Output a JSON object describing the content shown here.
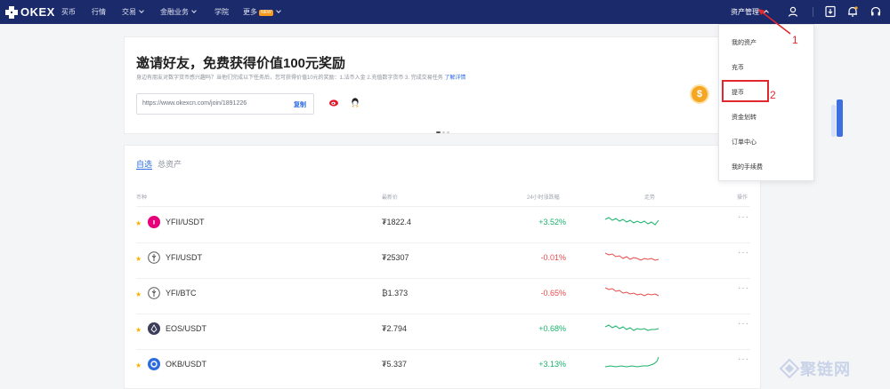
{
  "app": {
    "name": "OKEX"
  },
  "nav": {
    "items": [
      {
        "label": "买币"
      },
      {
        "label": "行情"
      },
      {
        "label": "交易"
      },
      {
        "label": "金融业务"
      },
      {
        "label": "学院"
      },
      {
        "label": "更多"
      }
    ],
    "new_badge": "NEW",
    "asset_management": "资产管理",
    "icons": [
      "user-icon",
      "download-icon",
      "bell-icon",
      "headset-icon"
    ]
  },
  "banner": {
    "title": "邀请好友，免费获得价值100元奖励",
    "subtitle": "身边有朋友对数字货币感兴趣吗？当他们完成以下任务后，您可获得价值10元的奖励：1.法币入金 2.充值数字货币 3. 完成交易任务",
    "learn_more": "了解详情",
    "invite_url": "https://www.okexcn.com/join/1891226",
    "copy_label": "复制",
    "coin_symbol": "$"
  },
  "assets": {
    "tabs": [
      {
        "label": "自选",
        "active": true
      },
      {
        "label": "总资产",
        "active": false
      }
    ],
    "headers": {
      "pair": "币种",
      "price": "最新价",
      "change": "24小时涨跌幅",
      "trend": "走势",
      "action": "操作"
    },
    "rows": [
      {
        "pair": "YFII/USDT",
        "price": "₮1822.4",
        "change": "+3.52%",
        "direction": "up",
        "coin_color": "#e6007a",
        "coin_icon": "yfii-icon"
      },
      {
        "pair": "YFI/USDT",
        "price": "₮25307",
        "change": "-0.01%",
        "direction": "down",
        "coin_color": "#ffffff",
        "coin_icon": "yfi-icon"
      },
      {
        "pair": "YFI/BTC",
        "price": "₿1.373",
        "change": "-0.65%",
        "direction": "down",
        "coin_color": "#ffffff",
        "coin_icon": "yfi-icon"
      },
      {
        "pair": "EOS/USDT",
        "price": "₮2.794",
        "change": "+0.68%",
        "direction": "up",
        "coin_color": "#3b3d5a",
        "coin_icon": "eos-icon"
      },
      {
        "pair": "OKB/USDT",
        "price": "₮5.337",
        "change": "+3.13%",
        "direction": "up",
        "coin_color": "#2d6cdf",
        "coin_icon": "okb-icon"
      }
    ]
  },
  "dropdown": {
    "items": [
      {
        "label": "我的资产"
      },
      {
        "label": "充币"
      },
      {
        "label": "提币",
        "highlighted": true
      },
      {
        "label": "资金划转"
      },
      {
        "label": "订单中心"
      },
      {
        "label": "我的手续费"
      }
    ]
  },
  "annotations": {
    "first": "1",
    "second": "2"
  },
  "watermark": {
    "text": "聚链网"
  },
  "colors": {
    "nav_bg": "#1b2a6b",
    "up": "#17b26a",
    "down": "#e84a4a",
    "accent": "#2d6cdf",
    "annotation": "#e0282e"
  }
}
